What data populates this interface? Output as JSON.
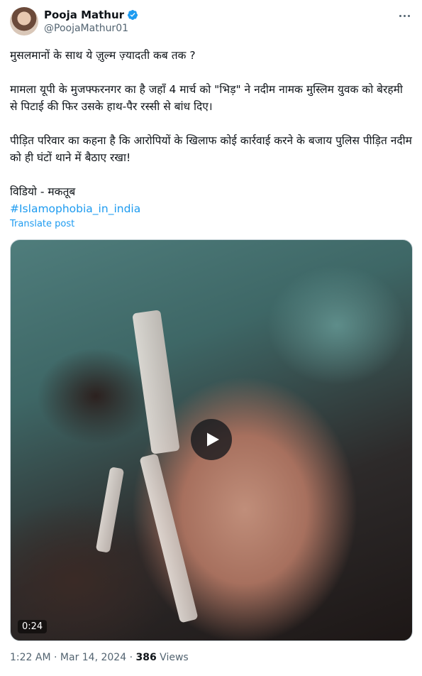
{
  "author": {
    "name": "Pooja Mathur",
    "handle": "@PoojaMathur01",
    "verified_color": "#1d9bf0"
  },
  "post": {
    "paragraphs": [
      "मुसलमानों के साथ ये ज़ुल्म ज़्यादती कब तक ?",
      "मामला यूपी के मुजफ्फरनगर का है जहाँ 4 मार्च को \"भिड़\" ने नदीम नामक मुस्लिम युवक को बेरहमी से पिटाई की फिर उसके हाथ-पैर रस्सी से बांध दिए।",
      "पीड़ित परिवार का कहना है कि आरोपियों  के खिलाफ कोई कार्रवाई करने के बजाय पुलिस पीड़ित नदीम को ही घंटों थाने में बैठाए रखा!",
      "विडियो - मकतूब"
    ],
    "hashtag": "#Islamophobia_in_india",
    "translate_label": "Translate post"
  },
  "media": {
    "duration": "0:24"
  },
  "meta": {
    "time": "1:22 AM",
    "separator": "·",
    "date": "Mar 14, 2024",
    "views_count": "386",
    "views_label": "Views"
  },
  "colors": {
    "accent": "#1d9bf0",
    "secondary_text": "#536471"
  }
}
